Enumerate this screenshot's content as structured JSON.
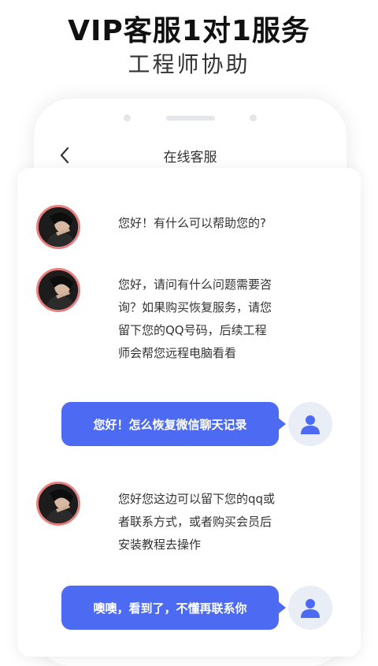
{
  "headline": "VIP客服1对1服务",
  "subline": "工程师协助",
  "phone": {
    "nav_title": "在线客服",
    "back_icon": "chevron-left-icon"
  },
  "chat": {
    "agent_messages": [
      "您好！有什么可以帮助您的?",
      "您好，请问有什么问题需要咨\n询？如果购买恢复服务，请您\n留下您的QQ号码，后续工程\n师会帮您远程电脑看看",
      "您好您这边可以留下您的qq或\n者联系方式，或者购买会员后\n安装教程去操作"
    ],
    "user_messages": [
      "您好！怎么恢复微信聊天记录",
      "噢噢，看到了，不懂再联系你"
    ]
  },
  "colors": {
    "accent": "#4d6af2",
    "avatar_ring": "#e98080",
    "user_avatar_bg": "#e9edf6"
  }
}
